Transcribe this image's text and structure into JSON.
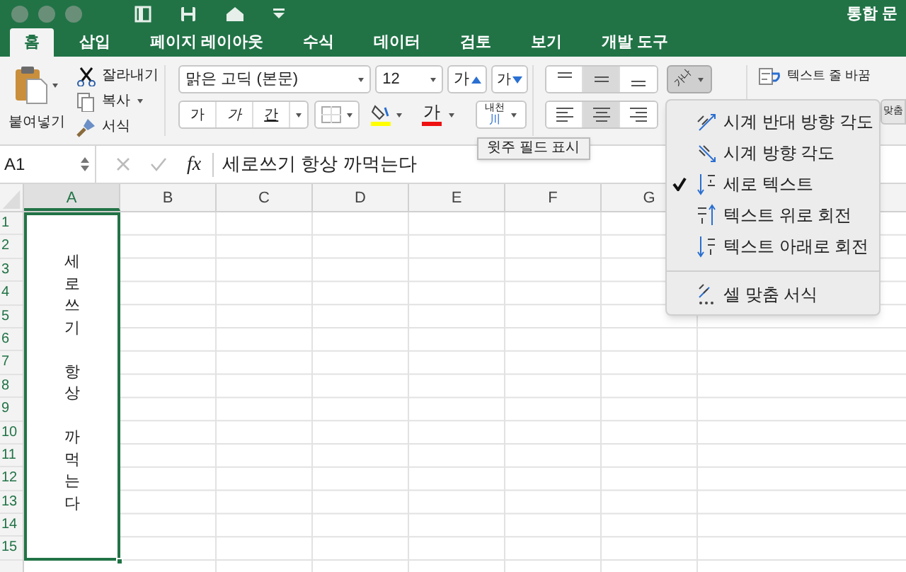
{
  "window": {
    "title": "통합 문"
  },
  "tabs": [
    {
      "label": "홈",
      "selected": true
    },
    {
      "label": "삽입",
      "selected": false
    },
    {
      "label": "페이지 레이아웃",
      "selected": false
    },
    {
      "label": "수식",
      "selected": false
    },
    {
      "label": "데이터",
      "selected": false
    },
    {
      "label": "검토",
      "selected": false
    },
    {
      "label": "보기",
      "selected": false
    },
    {
      "label": "개발 도구",
      "selected": false
    }
  ],
  "clipboard": {
    "paste": "붙여넣기",
    "cut": "잘라내기",
    "copy": "복사",
    "format_painter": "서식"
  },
  "font": {
    "name": "맑은 고딕 (본문)",
    "size": "12",
    "grow": "가",
    "shrink": "가",
    "bold": "가",
    "italic": "가",
    "underline": "간",
    "font_color": "가",
    "phonetic_top": "내천",
    "phonetic_bottom": "川"
  },
  "alignment": {
    "vertical": [
      {
        "kind": "top",
        "selected": false
      },
      {
        "kind": "middle",
        "selected": true
      },
      {
        "kind": "bottom",
        "selected": false
      }
    ],
    "horizontal": [
      {
        "kind": "left",
        "selected": false
      },
      {
        "kind": "center",
        "selected": true
      },
      {
        "kind": "right",
        "selected": false
      }
    ],
    "orientation_label": "가나",
    "orientation_open": true,
    "wrap_text": "텍스트 줄 바꿈",
    "merge": "맞춤"
  },
  "tooltip": "윗주 필드 표시",
  "formula_bar": {
    "name_box": "A1",
    "fx": "fx",
    "value": "세로쓰기 항상 까먹는다"
  },
  "columns": [
    "A",
    "B",
    "C",
    "D",
    "E",
    "F",
    "G"
  ],
  "rows": [
    "1",
    "2",
    "3",
    "4",
    "5",
    "6",
    "7",
    "8",
    "9",
    "10",
    "11",
    "12",
    "13",
    "14",
    "15"
  ],
  "cell_a1": {
    "text": "세로쓰기 항상 까먹는다",
    "selected": true
  },
  "orientation_menu": {
    "items": [
      {
        "kind": "ccw",
        "label": "시계 반대 방향 각도",
        "checked": false
      },
      {
        "kind": "cw",
        "label": "시계 방향 각도",
        "checked": false
      },
      {
        "kind": "vertical",
        "label": "세로 텍스트",
        "checked": true
      },
      {
        "kind": "up",
        "label": "텍스트 위로 회전",
        "checked": false
      },
      {
        "kind": "down",
        "label": "텍스트 아래로 회전",
        "checked": false
      }
    ],
    "footer": "셀 맞춤 서식"
  }
}
